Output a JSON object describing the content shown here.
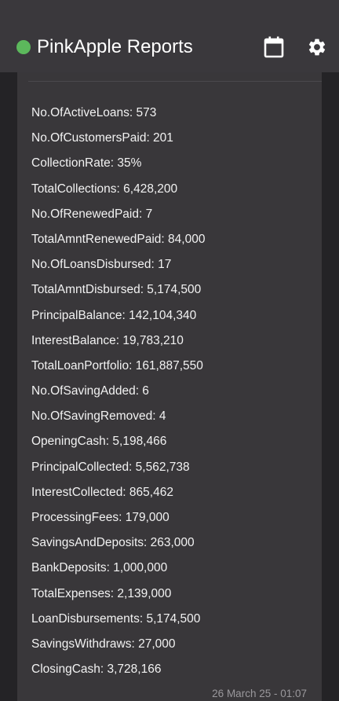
{
  "header": {
    "title": "PinkApple Reports",
    "status_color": "#5cb85c",
    "actions": [
      {
        "icon": "calendar-icon"
      },
      {
        "icon": "gear-icon"
      }
    ]
  },
  "report": {
    "items": [
      "No.OfActiveLoans: 573",
      "No.OfCustomersPaid: 201",
      "CollectionRate: 35%",
      "TotalCollections: 6,428,200",
      "No.OfRenewedPaid: 7",
      "TotalAmntRenewedPaid: 84,000",
      "No.OfLoansDisbursed: 17",
      "TotalAmntDisbursed: 5,174,500",
      "PrincipalBalance: 142,104,340",
      "InterestBalance: 19,783,210",
      "TotalLoanPortfolio: 161,887,550",
      "No.OfSavingAdded: 6",
      "No.OfSavingRemoved: 4",
      "OpeningCash: 5,198,466",
      "PrincipalCollected: 5,562,738",
      "InterestCollected: 865,462",
      "ProcessingFees: 179,000",
      "SavingsAndDeposits: 263,000",
      "BankDeposits: 1,000,000",
      "TotalExpenses: 2,139,000",
      "LoanDisbursements: 5,174,500",
      "SavingsWithdraws: 27,000",
      "ClosingCash: 3,728,166"
    ],
    "timestamp": "26 March 25 - 01:07"
  }
}
